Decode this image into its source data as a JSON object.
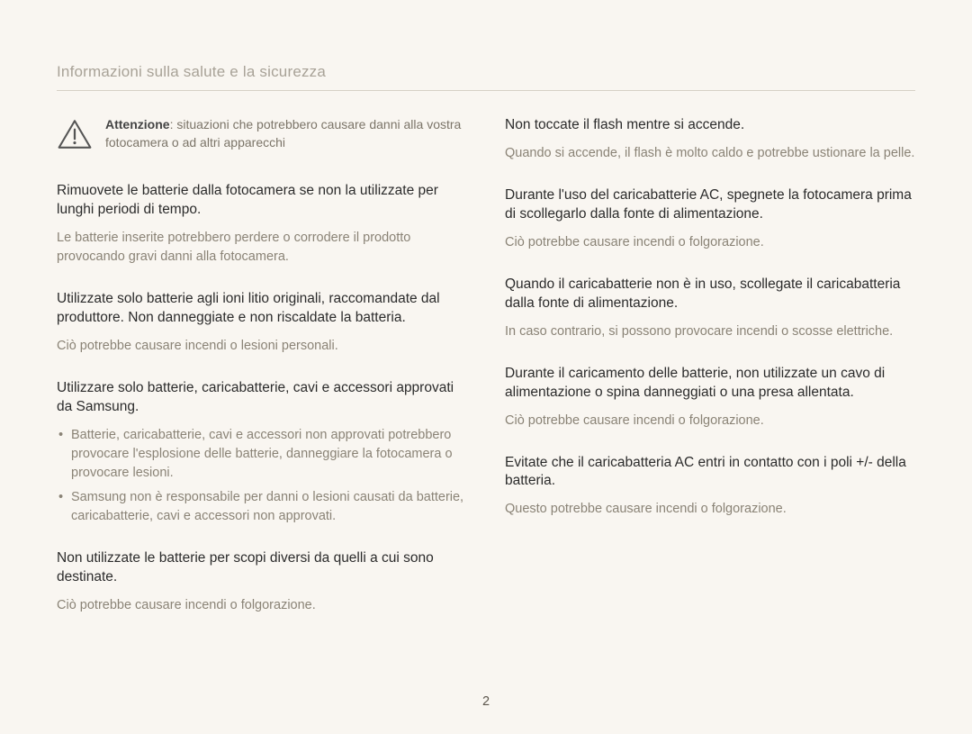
{
  "header": {
    "title": "Informazioni sulla salute e la sicurezza"
  },
  "caution": {
    "label": "Attenzione",
    "text": ": situazioni che potrebbero causare danni alla vostra fotocamera o ad altri apparecchi"
  },
  "left": {
    "s1": {
      "title": "Rimuovete le batterie dalla fotocamera se non la utilizzate per lunghi periodi di tempo.",
      "body": "Le batterie inserite potrebbero perdere o corrodere il prodotto provocando gravi danni alla fotocamera."
    },
    "s2": {
      "title": "Utilizzate solo batterie agli ioni litio originali, raccomandate dal produttore. Non danneggiate e non riscaldate la batteria.",
      "body": "Ciò potrebbe causare incendi o lesioni personali."
    },
    "s3": {
      "title": "Utilizzare solo batterie, caricabatterie, cavi e accessori approvati da Samsung.",
      "bullets": [
        "Batterie, caricabatterie, cavi e accessori non approvati potrebbero provocare l'esplosione delle batterie, danneggiare la fotocamera o provocare lesioni.",
        "Samsung non è responsabile per danni o lesioni causati da batterie, caricabatterie, cavi e accessori non approvati."
      ]
    },
    "s4": {
      "title": "Non utilizzate le batterie per scopi diversi da quelli a cui sono destinate.",
      "body": "Ciò potrebbe causare incendi o folgorazione."
    }
  },
  "right": {
    "s1": {
      "title": "Non toccate il flash mentre si accende.",
      "body": "Quando si accende, il flash è molto caldo e potrebbe ustionare la pelle."
    },
    "s2": {
      "title": "Durante l'uso del caricabatterie AC, spegnete la fotocamera prima di scollegarlo dalla fonte di alimentazione.",
      "body": "Ciò potrebbe causare incendi o folgorazione."
    },
    "s3": {
      "title": "Quando il caricabatterie non è in uso, scollegate il caricabatteria dalla fonte di alimentazione.",
      "body": "In caso contrario, si possono provocare incendi o scosse elettriche."
    },
    "s4": {
      "title": "Durante il caricamento delle batterie, non utilizzate un cavo di alimentazione o spina danneggiati o una presa allentata.",
      "body": "Ciò potrebbe causare incendi o folgorazione."
    },
    "s5": {
      "title": "Evitate che il caricabatteria AC entri in contatto con i poli +/- della batteria.",
      "body": "Questo potrebbe causare incendi o folgorazione."
    }
  },
  "pageNumber": "2"
}
